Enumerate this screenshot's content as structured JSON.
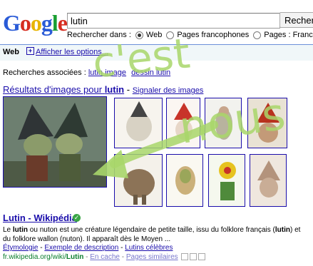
{
  "header": {
    "logo": {
      "letters": [
        "G",
        "o",
        "o",
        "g",
        "l",
        "e"
      ],
      "colors": [
        "#2a5bd7",
        "#d62d20",
        "#e8b400",
        "#2a5bd7",
        "#1a9e32",
        "#d62d20"
      ]
    },
    "search_value": "lutin",
    "search_button": "Rechercher",
    "scope": {
      "label": "Rechercher dans :",
      "options": [
        {
          "label": "Web",
          "selected": true
        },
        {
          "label": "Pages francophones",
          "selected": false
        },
        {
          "label": "Pages : France",
          "selected": false
        }
      ]
    }
  },
  "toolbar": {
    "web_label": "Web",
    "options_link": "Afficher les options..."
  },
  "related": {
    "label": "Recherches associées :",
    "items": [
      "lutin image",
      "dessin lutin"
    ]
  },
  "images": {
    "title_prefix": "Résultats d'images pour",
    "query": "lutin",
    "separator": "-",
    "signal_link": "Signaler des images"
  },
  "result": {
    "title": "Lutin - Wikipédia",
    "snippet": [
      {
        "t": "Le "
      },
      {
        "t": "lutin",
        "b": true
      },
      {
        "t": " ou nuton est une créature légendaire de petite taille, issu du folklore français ("
      },
      {
        "t": "lutin",
        "b": true
      },
      {
        "t": ") et du folklore wallon (nuton). Il apparaît dès le Moyen ..."
      }
    ],
    "links": [
      "Étymologie",
      "Exemple de description",
      "Lutins célèbres"
    ],
    "link_sep": " - ",
    "url_prefix": "fr.wikipedia.org/wiki/",
    "url_bold": "Lutin",
    "cache_link": "En cache",
    "similar_link": "Pages similaires"
  },
  "annotation": {
    "text": "c'est nous",
    "color": "#a8d66a"
  }
}
